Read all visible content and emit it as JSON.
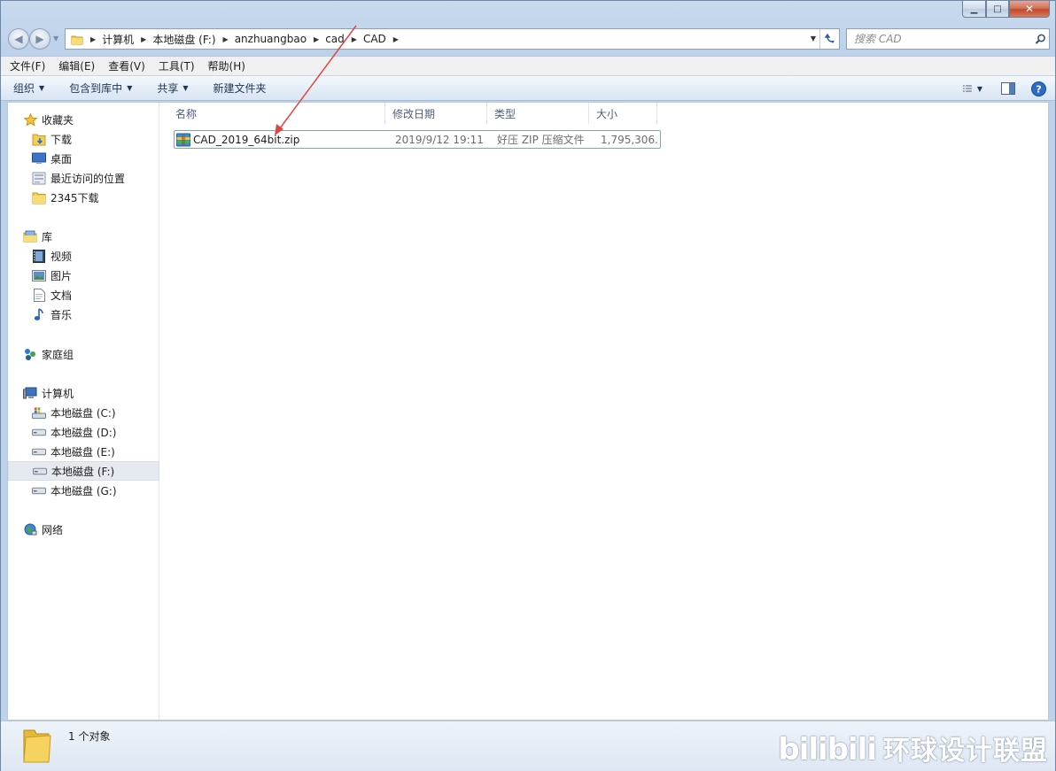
{
  "window": {
    "controls": {
      "minimize": "▁",
      "maximize": "□",
      "close": "✕"
    }
  },
  "nav": {
    "back_glyph": "◀",
    "forward_glyph": "▶",
    "breadcrumbs": [
      "计算机",
      "本地磁盘 (F:)",
      "anzhuangbao",
      "cad",
      "CAD"
    ],
    "search_placeholder": "搜索 CAD"
  },
  "menubar": {
    "items": [
      "文件(F)",
      "编辑(E)",
      "查看(V)",
      "工具(T)",
      "帮助(H)"
    ]
  },
  "cmdbar": {
    "organize": "组织",
    "include_in_library": "包含到库中",
    "share": "共享",
    "new_folder": "新建文件夹"
  },
  "sidebar": {
    "favorites": {
      "label": "收藏夹",
      "items": [
        "下载",
        "桌面",
        "最近访问的位置",
        "2345下载"
      ]
    },
    "libraries": {
      "label": "库",
      "items": [
        "视频",
        "图片",
        "文档",
        "音乐"
      ]
    },
    "homegroup": {
      "label": "家庭组"
    },
    "computer": {
      "label": "计算机",
      "items": [
        "本地磁盘 (C:)",
        "本地磁盘 (D:)",
        "本地磁盘 (E:)",
        "本地磁盘 (F:)",
        "本地磁盘 (G:)"
      ]
    },
    "network": {
      "label": "网络"
    }
  },
  "filelist": {
    "columns": [
      "名称",
      "修改日期",
      "类型",
      "大小"
    ],
    "rows": [
      {
        "name": "CAD_2019_64bit.zip",
        "date": "2019/9/12 19:11",
        "type": "好压 ZIP 压缩文件",
        "size": "1,795,306..."
      }
    ]
  },
  "status": {
    "count": "1 个对象"
  },
  "watermark": {
    "text": "环球设计联盟"
  },
  "colors": {
    "accent_arrow": "#e0463e",
    "selection_border": "#7da2ce",
    "title_bg": "#bcd1ea"
  }
}
